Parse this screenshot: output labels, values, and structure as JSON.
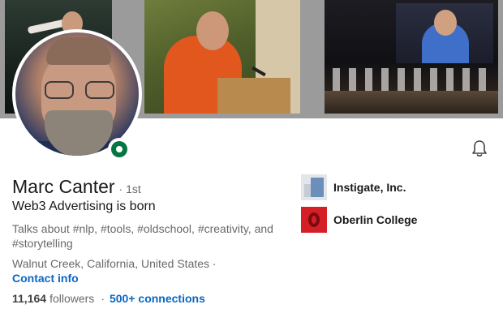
{
  "profile": {
    "name": "Marc Canter",
    "degree": "· 1st",
    "headline": "Web3 Advertising is born",
    "talks_about": "Talks about #nlp, #tools, #oldschool, #creativity, and #storytelling",
    "location": "Walnut Creek, California, United States ·",
    "contact_info": "Contact info",
    "followers_count": "11,164",
    "followers_label": "followers",
    "separator": "·",
    "connections": "500+ connections",
    "status": "online"
  },
  "organizations": [
    {
      "name": "Instigate, Inc.",
      "logo": "instigate-logo"
    },
    {
      "name": "Oberlin College",
      "logo": "oberlin-logo"
    }
  ],
  "icons": {
    "notification": "bell-icon",
    "status": "open-to-work-dot"
  },
  "colors": {
    "link": "#0a66c2",
    "status_green": "#057642",
    "oberlin_red": "#d51f26"
  }
}
